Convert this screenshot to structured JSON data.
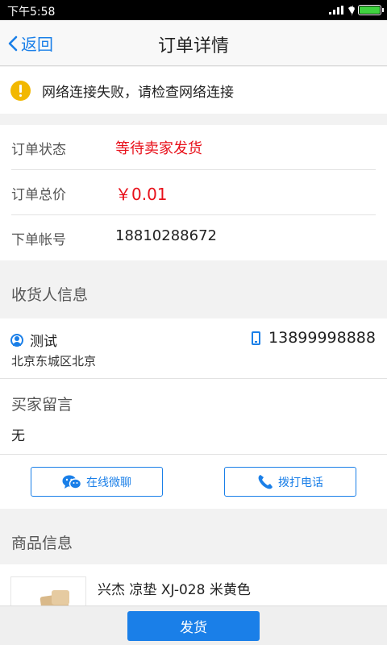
{
  "statusbar": {
    "time": "下午5:58"
  },
  "nav": {
    "back_label": "返回",
    "title": "订单详情"
  },
  "alert": {
    "message": "网络连接失败，请检查网络连接"
  },
  "order": {
    "rows": [
      {
        "label": "订单状态",
        "value": "等待卖家发货"
      },
      {
        "label": "订单总价",
        "value": "￥0.01"
      },
      {
        "label": "下单帐号",
        "value": "18810288672"
      }
    ]
  },
  "receiver": {
    "header": "收货人信息",
    "name": "测试",
    "phone": "13899998888",
    "address": "北京东城区北京"
  },
  "buyer_message": {
    "header": "买家留言",
    "value": "无"
  },
  "actions": {
    "wechat_label": "在线微聊",
    "call_label": "拨打电话"
  },
  "goods": {
    "header": "商品信息",
    "name": "兴杰 凉垫 XJ-028 米黄色"
  },
  "bottom": {
    "ship_label": "发货"
  },
  "colors": {
    "accent": "#1a7fe8",
    "status_red": "#e8101a",
    "warning": "#f2b800"
  }
}
